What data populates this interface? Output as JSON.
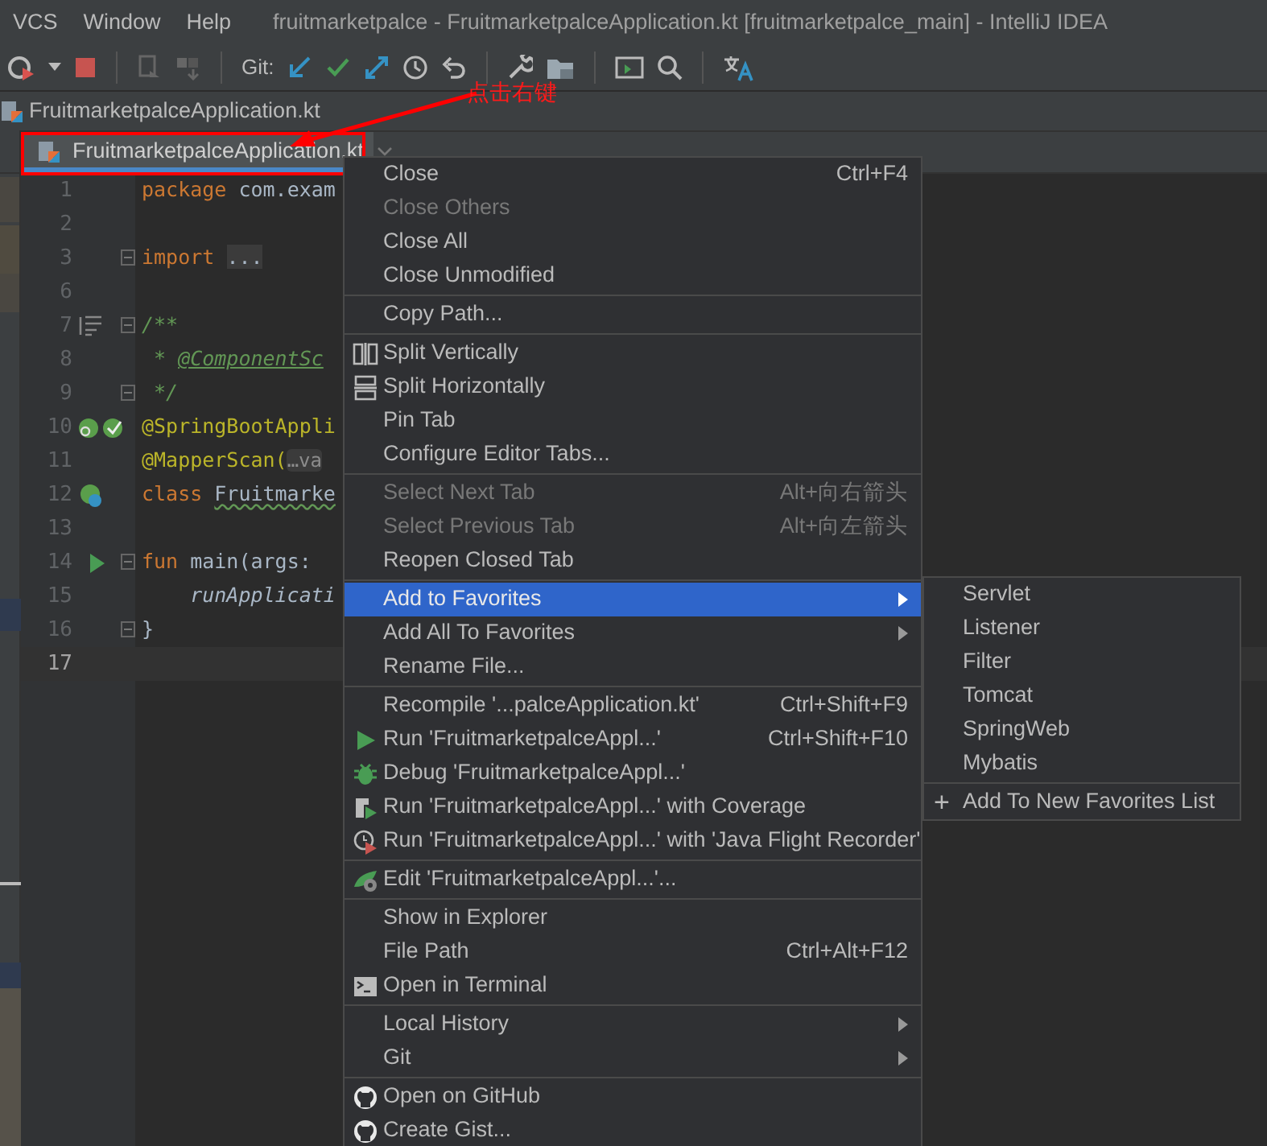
{
  "menu_bar": [
    {
      "label": "VCS"
    },
    {
      "label": "Window"
    },
    {
      "label": "Help"
    }
  ],
  "window": {
    "title": "fruitmarketpalce - FruitmarketpalceApplication.kt [fruitmarketpalce_main] - IntelliJ IDEA"
  },
  "toolbar": {
    "git_label": "Git:"
  },
  "breadcrumb": {
    "file": "FruitmarketpalceApplication.kt"
  },
  "tabs": [
    {
      "label": "FruitmarketpalceApplication.kt",
      "selected": true
    }
  ],
  "editor": {
    "lines": [
      {
        "number": "1",
        "current": false,
        "tokens": [
          {
            "text": "package ",
            "kind": "kw"
          },
          {
            "text": "com.exam",
            "kind": "plain"
          }
        ]
      },
      {
        "number": "2",
        "current": false
      },
      {
        "number": "3",
        "current": false,
        "tokens": [
          {
            "text": "import ",
            "kind": "kw"
          },
          {
            "text": "...",
            "kind": "fold"
          }
        ]
      },
      {
        "number": "6",
        "current": false
      },
      {
        "number": "7",
        "current": false,
        "tokens": [
          {
            "text": "/**",
            "kind": "comment"
          }
        ]
      },
      {
        "number": "8",
        "current": false,
        "tokens": [
          {
            "text": " * ",
            "kind": "comment"
          },
          {
            "text": "@ComponentSc",
            "kind": "doctag"
          }
        ]
      },
      {
        "number": "9",
        "current": false,
        "tokens": [
          {
            "text": " */",
            "kind": "comment"
          }
        ]
      },
      {
        "number": "10",
        "current": false,
        "tokens": [
          {
            "text": "@SpringBootAppli",
            "kind": "annotation"
          }
        ]
      },
      {
        "number": "11",
        "current": false,
        "tokens": [
          {
            "text": "@MapperScan(",
            "kind": "annotation"
          },
          {
            "text": "…va",
            "kind": "hint"
          }
        ]
      },
      {
        "number": "12",
        "current": false,
        "tokens": [
          {
            "text": "class ",
            "kind": "kw"
          },
          {
            "text": "Fruitmarke",
            "kind": "warn"
          }
        ]
      },
      {
        "number": "13",
        "current": false
      },
      {
        "number": "14",
        "current": false,
        "tokens": [
          {
            "text": "fun ",
            "kind": "kw"
          },
          {
            "text": "main(args:",
            "kind": "plain"
          }
        ]
      },
      {
        "number": "15",
        "current": false,
        "tokens": [
          {
            "text": "    runApplicati",
            "kind": "call"
          }
        ]
      },
      {
        "number": "16",
        "current": false,
        "tokens": [
          {
            "text": "}",
            "kind": "plain"
          }
        ]
      },
      {
        "number": "17",
        "current": true
      }
    ]
  },
  "context_menu": {
    "groups": [
      [
        {
          "label": "Close",
          "shortcut": "Ctrl+F4",
          "disabled": false,
          "selected": false,
          "submenu": false
        },
        {
          "label": "Close Others",
          "disabled": true,
          "selected": false,
          "submenu": false
        },
        {
          "label": "Close All",
          "disabled": false,
          "selected": false,
          "submenu": false
        },
        {
          "label": "Close Unmodified",
          "disabled": false,
          "selected": false,
          "submenu": false
        }
      ],
      [
        {
          "label": "Copy Path...",
          "disabled": false,
          "selected": false,
          "submenu": false
        }
      ],
      [
        {
          "label": "Split Vertically",
          "disabled": false,
          "selected": false,
          "submenu": false
        },
        {
          "label": "Split Horizontally",
          "disabled": false,
          "selected": false,
          "submenu": false
        },
        {
          "label": "Pin Tab",
          "disabled": false,
          "selected": false,
          "submenu": false
        },
        {
          "label": "Configure Editor Tabs...",
          "disabled": false,
          "selected": false,
          "submenu": false
        }
      ],
      [
        {
          "label": "Select Next Tab",
          "shortcut": "Alt+向右箭头",
          "disabled": true,
          "selected": false,
          "submenu": false
        },
        {
          "label": "Select Previous Tab",
          "shortcut": "Alt+向左箭头",
          "disabled": true,
          "selected": false,
          "submenu": false
        },
        {
          "label": "Reopen Closed Tab",
          "disabled": false,
          "selected": false,
          "submenu": false
        }
      ],
      [
        {
          "label": "Add to Favorites",
          "disabled": false,
          "selected": true,
          "submenu": true
        },
        {
          "label": "Add All To Favorites",
          "disabled": false,
          "selected": false,
          "submenu": true
        },
        {
          "label": "Rename File...",
          "disabled": false,
          "selected": false,
          "submenu": false
        }
      ],
      [
        {
          "label": "Recompile '...palceApplication.kt'",
          "shortcut": "Ctrl+Shift+F9",
          "disabled": false,
          "selected": false,
          "submenu": false
        },
        {
          "label": "Run 'FruitmarketpalceAppl...'",
          "shortcut": "Ctrl+Shift+F10",
          "disabled": false,
          "selected": false,
          "submenu": false
        },
        {
          "label": "Debug 'FruitmarketpalceAppl...'",
          "disabled": false,
          "selected": false,
          "submenu": false
        },
        {
          "label": "Run 'FruitmarketpalceAppl...' with Coverage",
          "disabled": false,
          "selected": false,
          "submenu": false
        },
        {
          "label": "Run 'FruitmarketpalceAppl...' with 'Java Flight Recorder'",
          "disabled": false,
          "selected": false,
          "submenu": false
        }
      ],
      [
        {
          "label": "Edit 'FruitmarketpalceAppl...'...",
          "disabled": false,
          "selected": false,
          "submenu": false
        }
      ],
      [
        {
          "label": "Show in Explorer",
          "disabled": false,
          "selected": false,
          "submenu": false
        },
        {
          "label": "File Path",
          "shortcut": "Ctrl+Alt+F12",
          "disabled": false,
          "selected": false,
          "submenu": false
        },
        {
          "label": "Open in Terminal",
          "disabled": false,
          "selected": false,
          "submenu": false
        }
      ],
      [
        {
          "label": "Local History",
          "disabled": false,
          "selected": false,
          "submenu": true
        },
        {
          "label": "Git",
          "disabled": false,
          "selected": false,
          "submenu": true
        }
      ],
      [
        {
          "label": "Open on GitHub",
          "disabled": false,
          "selected": false,
          "submenu": false
        },
        {
          "label": "Create Gist...",
          "disabled": false,
          "selected": false,
          "submenu": false
        }
      ]
    ]
  },
  "submenu": {
    "items": [
      {
        "label": "Servlet"
      },
      {
        "label": "Listener"
      },
      {
        "label": "Filter"
      },
      {
        "label": "Tomcat"
      },
      {
        "label": "SpringWeb"
      },
      {
        "label": "Mybatis"
      }
    ],
    "footer": {
      "plus": "+",
      "label": "Add To New Favorites List"
    }
  },
  "annotation": {
    "text": "点击右键"
  }
}
